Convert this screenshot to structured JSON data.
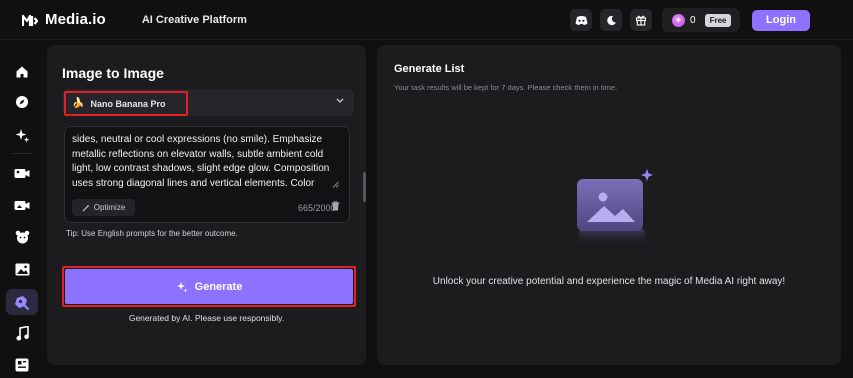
{
  "header": {
    "brand": "Media.io",
    "tagline": "AI Creative Platform",
    "icons": [
      "discord-icon",
      "moon-icon",
      "gift-icon"
    ],
    "credits": "0",
    "plan_badge": "Free",
    "login_label": "Login"
  },
  "sidebar": {
    "items": [
      {
        "icon": "home-icon"
      },
      {
        "icon": "explore-icon"
      },
      {
        "icon": "sparkle-icon"
      },
      {
        "icon": "video-icon"
      },
      {
        "icon": "image-video-icon"
      },
      {
        "icon": "avatar-icon"
      },
      {
        "icon": "image-icon"
      },
      {
        "icon": "image-edit-icon",
        "active": true
      },
      {
        "icon": "music-icon"
      },
      {
        "icon": "tools-icon"
      }
    ]
  },
  "left_panel": {
    "title": "Image to Image",
    "model": {
      "icon": "banana-icon",
      "label": "Nano Banana Pro"
    },
    "prompt_text": "sides, neutral or cool expressions (no smile). Emphasize metallic reflections on elevator walls, subtle ambient cold light, low contrast shadows, slight edge glow. Composition uses strong diagonal lines and vertical elements. Color tone: steel grey and muted tones. Photorealistic, cinematic street",
    "optimize_label": "Optimize",
    "char_count": "665/2000",
    "tip": "Tip: Use English prompts for the better outcome.",
    "generate_label": "Generate",
    "generate_note": "Generated by AI. Please use responsibly."
  },
  "right_panel": {
    "title": "Generate List",
    "subtitle": "Your task results will be kept for 7 days. Please check them in time.",
    "empty_message": "Unlock your creative potential and experience the magic of Media AI right away!"
  },
  "colors": {
    "accent": "#8c72ff",
    "highlight": "#e32027",
    "panel": "#1c1c1f",
    "background": "#101011"
  }
}
